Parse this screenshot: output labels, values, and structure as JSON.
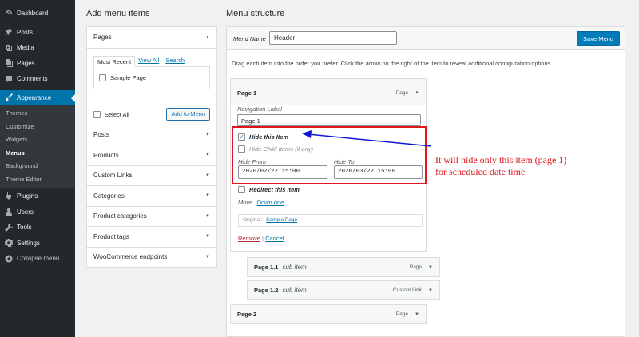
{
  "sidebar": {
    "items": [
      {
        "label": "Dashboard",
        "icon": "dashboard-icon"
      },
      {
        "label": "Posts",
        "icon": "pin-icon"
      },
      {
        "label": "Media",
        "icon": "media-icon"
      },
      {
        "label": "Pages",
        "icon": "page-icon"
      },
      {
        "label": "Comments",
        "icon": "comment-icon"
      },
      {
        "label": "Appearance",
        "icon": "brush-icon"
      }
    ],
    "sub_items": [
      "Themes",
      "Customize",
      "Widgets",
      "Menus",
      "Background",
      "Theme Editor"
    ],
    "bottom_items": [
      {
        "label": "Plugins",
        "icon": "plugin-icon"
      },
      {
        "label": "Users",
        "icon": "user-icon"
      },
      {
        "label": "Tools",
        "icon": "wrench-icon"
      },
      {
        "label": "Settings",
        "icon": "settings-icon"
      },
      {
        "label": "Collapse menu",
        "icon": "collapse-icon"
      }
    ]
  },
  "left": {
    "heading": "Add menu items",
    "pages_section": "Pages",
    "tabs": [
      "Most Recent",
      "View All",
      "Search"
    ],
    "sample_page": "Sample Page",
    "select_all": "Select All",
    "add_button": "Add to Menu",
    "sections": [
      "Posts",
      "Products",
      "Custom Links",
      "Categories",
      "Product categories",
      "Product tags",
      "WooCommerce endpoints"
    ]
  },
  "right": {
    "heading": "Menu structure",
    "menu_name_label": "Menu Name",
    "menu_name_value": "Header",
    "save_button": "Save Menu",
    "instructions": "Drag each item into the order you prefer. Click the arrow on the right of the item to reveal additional configuration options.",
    "item1": {
      "title": "Page 1",
      "type": "Page",
      "nav_label_caption": "Navigation Label",
      "nav_label_value": "Page 1",
      "hide_item": "Hide this Item",
      "hide_children": "Hide Child Items (if any)",
      "hide_from_label": "Hide From",
      "hide_from_value": "2020/02/22 15:00",
      "hide_to_label": "Hide To",
      "hide_to_value": "2020/03/22 15:00",
      "redirect": "Redirect this Item",
      "move_label": "Move",
      "move_link": "Down one",
      "original_label": "Original:",
      "original_link": "Sample Page",
      "remove": "Remove",
      "separator": "|",
      "cancel": "Cancel"
    },
    "subitems": [
      {
        "title": "Page 1.1",
        "sub": "sub item",
        "type": "Page"
      },
      {
        "title": "Page 1.2",
        "sub": "sub item",
        "type": "Custom Link"
      }
    ],
    "item2": {
      "title": "Page 2",
      "type": "Page"
    }
  },
  "annotation": {
    "line1": "It will hide only this item (page 1)",
    "line2": "for scheduled date time",
    "color": "#e0161e"
  }
}
